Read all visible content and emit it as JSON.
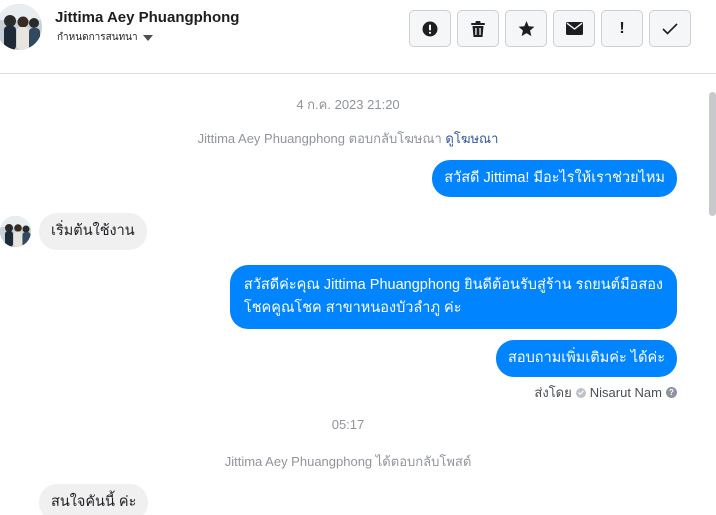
{
  "header": {
    "name": "Jittima Aey Phuangphong",
    "subtitle": "กำหนดการสนทนา",
    "actions": [
      {
        "icon": "alert-circle-icon",
        "label": ""
      },
      {
        "icon": "trash-icon",
        "label": ""
      },
      {
        "icon": "star-icon",
        "label": ""
      },
      {
        "icon": "envelope-icon",
        "label": ""
      },
      {
        "icon": "exclamation-icon",
        "label": "!"
      },
      {
        "icon": "checkmark-icon",
        "label": ""
      }
    ]
  },
  "conversation": {
    "date_1": "4 ก.ค. 2023 21:20",
    "ad_reply_text": "Jittima Aey Phuangphong ตอบกลับโฆษณา",
    "ad_link": "ดูโฆษณา",
    "msg_out_1": "สวัสดี Jittima! มีอะไรให้เราช่วยไหม",
    "msg_in_1": "เริ่มต้นใช้งาน",
    "msg_out_2_line1": "สวัสดีค่ะคุณ Jittima Phuangphong ยินดีต้อนรับสู่ร้าน รถยนต์มือสอง",
    "msg_out_2_line2": "โชคคูณโชค สาขาหนองบัวลำภู ค่ะ",
    "msg_out_3": "สอบถามเพิ่มเติมค่ะ ได้ค่ะ",
    "sent_by_label": "ส่งโดย",
    "sent_by_name": "Nisarut Nam",
    "date_2": "05:17",
    "post_reply_text": "Jittima Aey Phuangphong ได้ตอบกลับโพสต์",
    "msg_in_2": "สนใจคันนี้ ค่ะ"
  },
  "colors": {
    "outgoing": "#0084ff",
    "incoming": "#f1f0f0",
    "link": "#365899"
  }
}
